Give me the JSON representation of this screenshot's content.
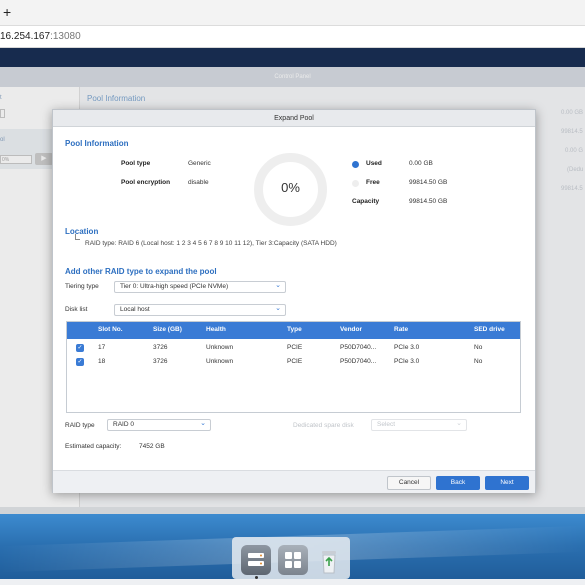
{
  "browser": {
    "new_tab_label": "+",
    "url_host": "16.254.167",
    "url_port": ":13080"
  },
  "control_panel": {
    "title": "Control Panel",
    "bg_left_labels": [
      "t",
      "ol",
      "0%"
    ],
    "bg_pool_title": "Pool Information",
    "bg_right_values": [
      "0.00 GB",
      "99814.5",
      "0.00 G",
      "(Dedu",
      "99814.5"
    ]
  },
  "dialog": {
    "title": "Expand Pool",
    "pool_info": {
      "heading": "Pool Information",
      "pool_type_label": "Pool type",
      "pool_type_value": "Generic",
      "pool_encryption_label": "Pool encryption",
      "pool_encryption_value": "disable",
      "donut_percent": "0%",
      "used_fraction": 0,
      "used_label": "Used",
      "used_value": "0.00 GB",
      "free_label": "Free",
      "free_value": "99814.50 GB",
      "capacity_label": "Capacity",
      "capacity_value": "99814.50 GB"
    },
    "location": {
      "heading": "Location",
      "text": "RAID type: RAID 6 (Local host: 1 2 3 4 5 6 7 8 9 10 11 12), Tier 3:Capacity (SATA HDD)"
    },
    "add_raid": {
      "heading": "Add other RAID type to expand the pool",
      "tiering_label": "Tiering type",
      "tiering_value": "Tier 0: Ultra-high speed (PCIe NVMe)",
      "disk_list_label": "Disk list",
      "disk_list_value": "Local host"
    },
    "table": {
      "columns": [
        "Slot No.",
        "Size (GB)",
        "Health",
        "Type",
        "Vendor",
        "Rate",
        "SED drive"
      ],
      "rows": [
        {
          "checked": true,
          "slot": "17",
          "size": "3726",
          "health": "Unknown",
          "type": "PCIE",
          "vendor": "P50D7040...",
          "rate": "PCIe 3.0",
          "sed": "No"
        },
        {
          "checked": true,
          "slot": "18",
          "size": "3726",
          "health": "Unknown",
          "type": "PCIE",
          "vendor": "P50D7040...",
          "rate": "PCIe 3.0",
          "sed": "No"
        }
      ]
    },
    "raid_type_label": "RAID type",
    "raid_type_value": "RAID 0",
    "spare_label": "Dedicated spare disk",
    "spare_placeholder": "Select",
    "estimated_label": "Estimated capacity:",
    "estimated_value": "7452 GB",
    "buttons": {
      "cancel": "Cancel",
      "back": "Back",
      "next": "Next"
    }
  },
  "colors": {
    "accent": "#3a7bd5",
    "heading": "#2d6fc0",
    "used_dot": "#2f73d0",
    "free_dot": "#eeeeee",
    "qts_topbar": "#1a2f55"
  },
  "dock": {
    "icons": [
      "storage-manager-icon",
      "app-center-icon",
      "recycle-bin-icon"
    ]
  }
}
